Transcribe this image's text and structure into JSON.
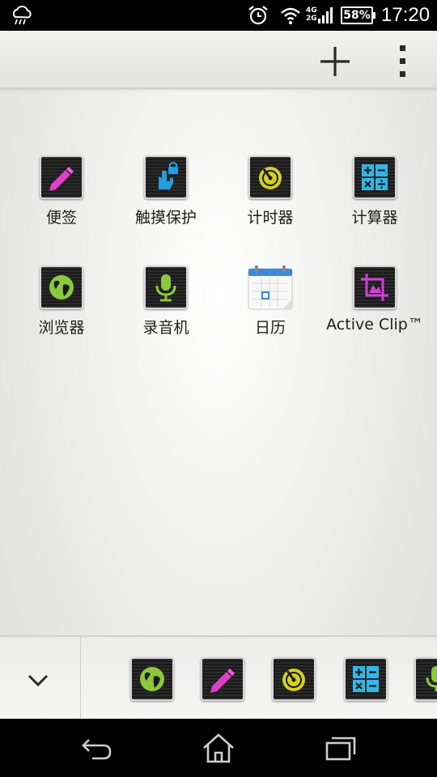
{
  "status_bar": {
    "network_top": "4G",
    "network_bottom": "2G",
    "battery": "58%",
    "time": "17:20",
    "icons": [
      "weather-rain-icon",
      "alarm-clock-icon",
      "wifi-icon",
      "signal-icon",
      "battery-icon"
    ]
  },
  "action_bar": {
    "icons": [
      "add-icon",
      "overflow-menu-icon"
    ]
  },
  "apps": [
    {
      "label": "便签",
      "icon": "note-pencil-icon",
      "color": "#e040c8"
    },
    {
      "label": "触摸保护",
      "icon": "touch-lock-icon",
      "color": "#1fa0e0"
    },
    {
      "label": "计时器",
      "icon": "timer-icon",
      "color": "#d4d020"
    },
    {
      "label": "计算器",
      "icon": "calculator-icon",
      "color": "#30b8e8"
    },
    {
      "label": "浏览器",
      "icon": "globe-icon",
      "color": "#8cc83c"
    },
    {
      "label": "录音机",
      "icon": "microphone-icon",
      "color": "#8cc83c"
    },
    {
      "label": "日历",
      "icon": "calendar-icon",
      "color": "#3a8ad8"
    },
    {
      "label": "Active Clip™",
      "icon": "crop-icon",
      "color": "#d040d8"
    }
  ],
  "dock": {
    "collapse_icon": "chevron-down-icon",
    "apps": [
      "globe-icon",
      "note-pencil-icon",
      "timer-icon",
      "calculator-icon",
      "microphone-icon"
    ]
  },
  "nav_bar": {
    "icons": [
      "back-icon",
      "home-icon",
      "recent-apps-icon"
    ]
  }
}
